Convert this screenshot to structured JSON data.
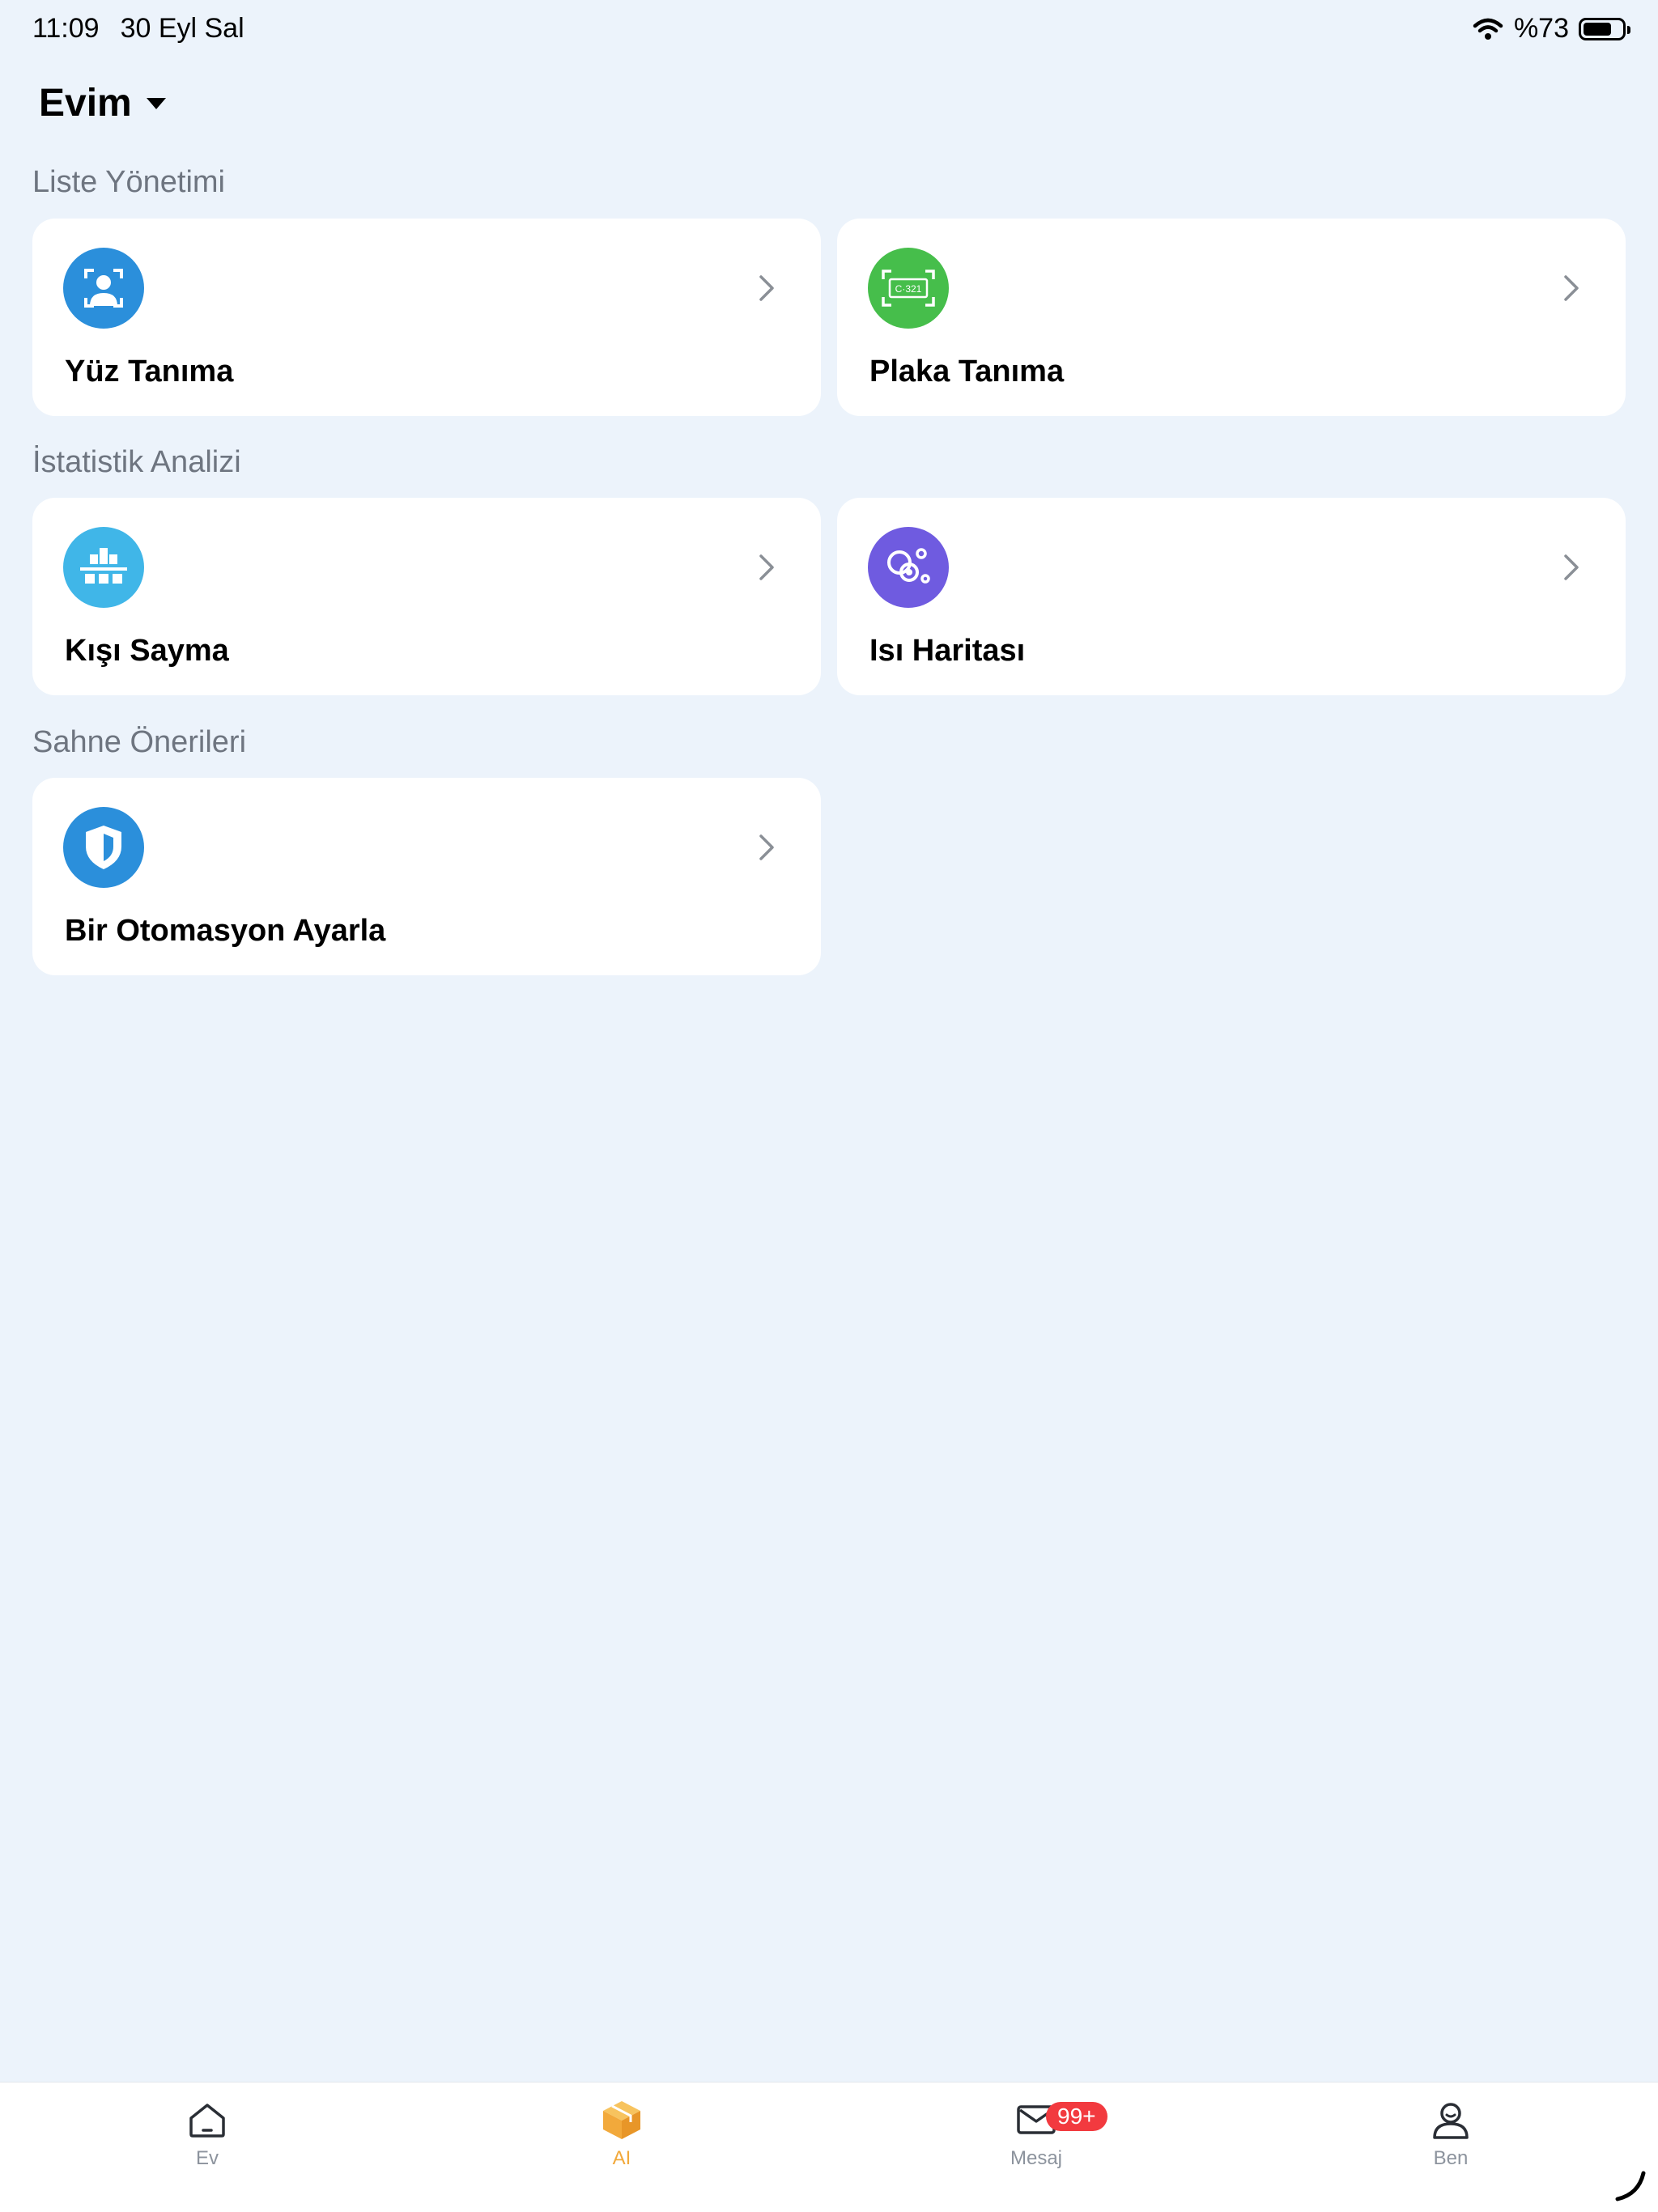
{
  "status_bar": {
    "time": "11:09",
    "date": "30 Eyl Sal",
    "battery": "%73",
    "battery_level": 0.73
  },
  "header": {
    "home_name": "Evim"
  },
  "sections": [
    {
      "title": "Liste Yönetimi",
      "items": [
        {
          "label": "Yüz Tanıma",
          "icon": "face-recognition-icon",
          "color": "#2B8FDB"
        },
        {
          "label": "Plaka Tanıma",
          "icon": "license-plate-icon",
          "color": "#46BE4B",
          "plate_text": "C·321"
        }
      ]
    },
    {
      "title": "İstatistik Analizi",
      "items": [
        {
          "label": "Kışı Sayma",
          "icon": "people-counting-icon",
          "color": "#40B6E8"
        },
        {
          "label": "Isı Haritası",
          "icon": "heat-map-icon",
          "color": "#6F5BE0"
        }
      ]
    },
    {
      "title": "Sahne Önerileri",
      "items": [
        {
          "label": "Bir Otomasyon Ayarla",
          "icon": "shield-icon",
          "color": "#2B8FDB"
        }
      ]
    }
  ],
  "tab_bar": {
    "tabs": [
      {
        "label": "Ev",
        "icon": "home-icon"
      },
      {
        "label": "AI",
        "icon": "ai-cube-icon",
        "active": true
      },
      {
        "label": "Mesaj",
        "icon": "mail-icon",
        "badge": "99+"
      },
      {
        "label": "Ben",
        "icon": "profile-icon"
      }
    ],
    "active_color": "#F2A93B",
    "badge_color": "#F23A3F"
  }
}
